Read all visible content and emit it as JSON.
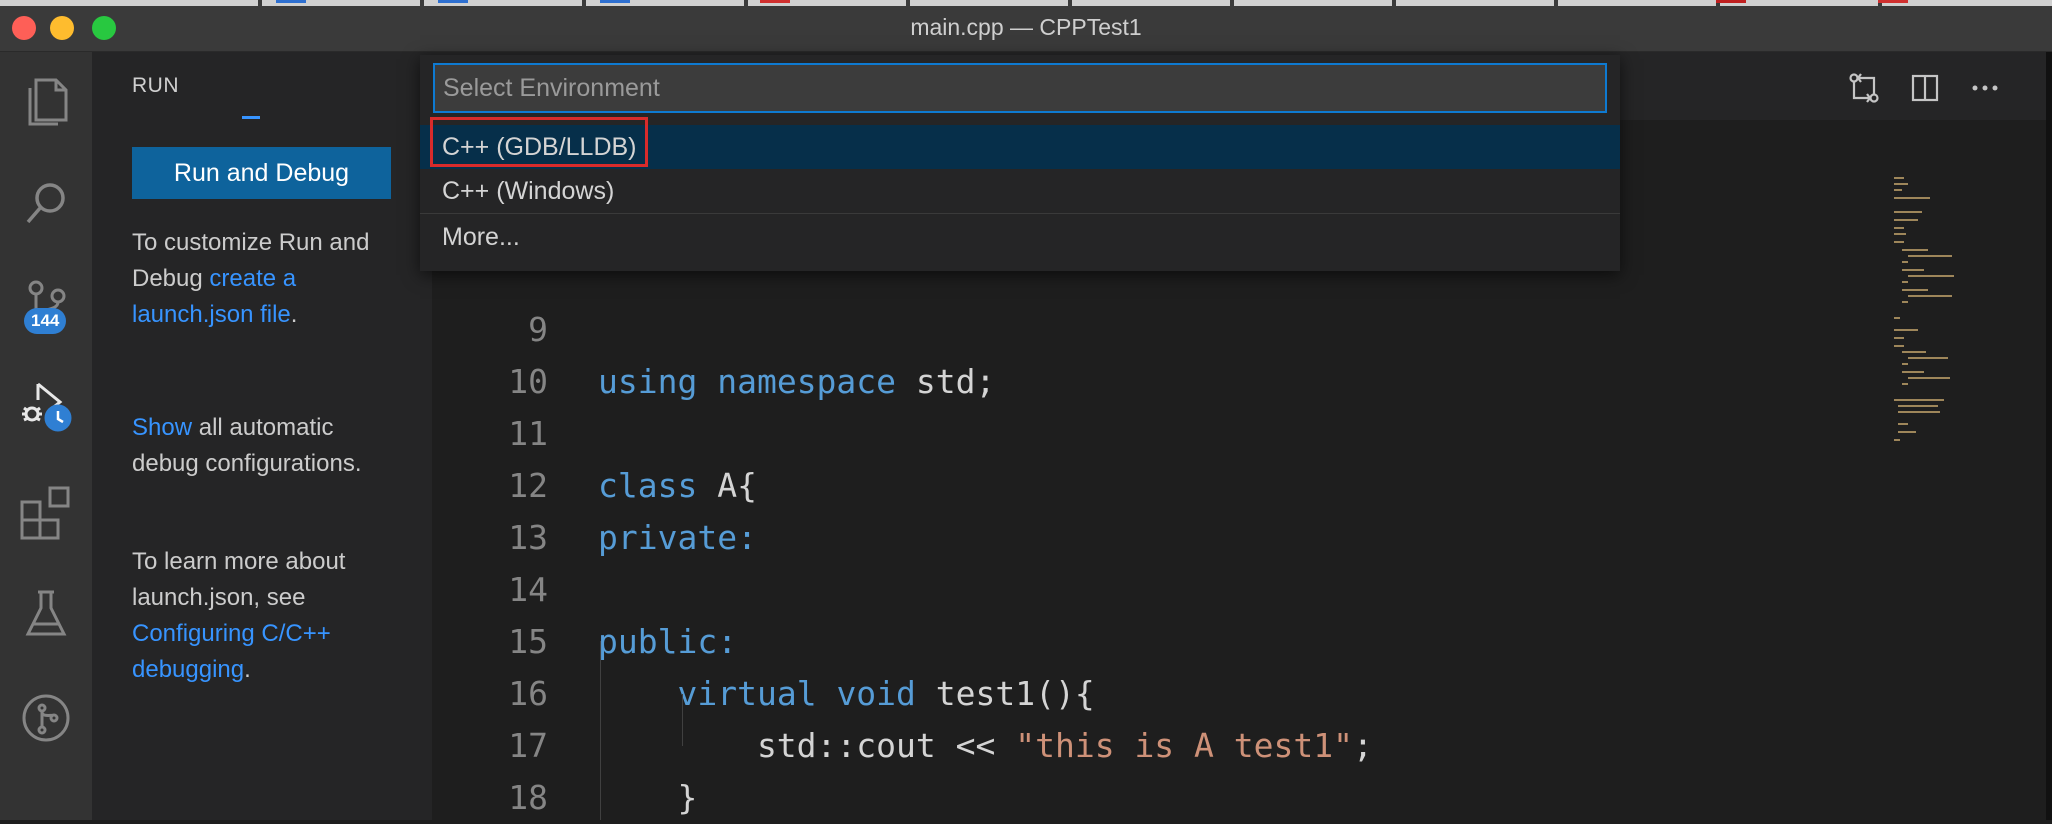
{
  "window": {
    "title": "main.cpp — CPPTest1"
  },
  "activity_bar": {
    "items": [
      {
        "icon": "explorer-icon"
      },
      {
        "icon": "search-icon"
      },
      {
        "icon": "source-control-icon",
        "badge": "144"
      },
      {
        "icon": "run-debug-icon"
      },
      {
        "icon": "extensions-icon"
      },
      {
        "icon": "testing-icon"
      },
      {
        "icon": "git-graph-icon"
      }
    ]
  },
  "sidebar": {
    "title": "RUN",
    "run_button": "Run and Debug",
    "para1": {
      "text": "To customize Run and Debug ",
      "link": "create a launch.json file",
      "tail": "."
    },
    "para2": {
      "link": "Show",
      "text": " all automatic debug configurations."
    },
    "para3": {
      "text": "To learn more about launch.json, see ",
      "link": "Configuring C/C++ debugging",
      "tail": "."
    }
  },
  "editor": {
    "actions": [
      "open-changes-icon",
      "split-editor-icon",
      "more-actions-icon"
    ],
    "lines": [
      {
        "num": "9",
        "tokens": []
      },
      {
        "num": "10",
        "tokens": [
          {
            "t": "using",
            "c": "kw"
          },
          {
            "t": " ",
            "c": ""
          },
          {
            "t": "namespace",
            "c": "kw"
          },
          {
            "t": " std;",
            "c": ""
          }
        ]
      },
      {
        "num": "11",
        "tokens": []
      },
      {
        "num": "12",
        "tokens": [
          {
            "t": "class",
            "c": "kw"
          },
          {
            "t": " A{",
            "c": ""
          }
        ]
      },
      {
        "num": "13",
        "tokens": [
          {
            "t": "private:",
            "c": "kw"
          }
        ]
      },
      {
        "num": "14",
        "tokens": []
      },
      {
        "num": "15",
        "tokens": [
          {
            "t": "public:",
            "c": "kw"
          }
        ]
      },
      {
        "num": "16",
        "tokens": [
          {
            "t": "    ",
            "c": ""
          },
          {
            "t": "virtual",
            "c": "kw"
          },
          {
            "t": " ",
            "c": ""
          },
          {
            "t": "void",
            "c": "kw"
          },
          {
            "t": " test1(){",
            "c": ""
          }
        ]
      },
      {
        "num": "17",
        "tokens": [
          {
            "t": "        std::cout << ",
            "c": ""
          },
          {
            "t": "\"this is A test1\"",
            "c": "str"
          },
          {
            "t": ";",
            "c": ""
          }
        ]
      },
      {
        "num": "18",
        "tokens": [
          {
            "t": "    }",
            "c": ""
          }
        ]
      }
    ]
  },
  "quick_pick": {
    "placeholder": "Select Environment",
    "items": [
      {
        "label": "C++ (GDB/LLDB)",
        "selected": true
      },
      {
        "label": "C++ (Windows)",
        "selected": false
      },
      {
        "label": "More...",
        "selected": false
      }
    ]
  },
  "colors": {
    "accent": "#0e639c",
    "link": "#3794ff",
    "keyword": "#569cd6",
    "string": "#ce9178",
    "highlight_box": "#d72b2b"
  }
}
